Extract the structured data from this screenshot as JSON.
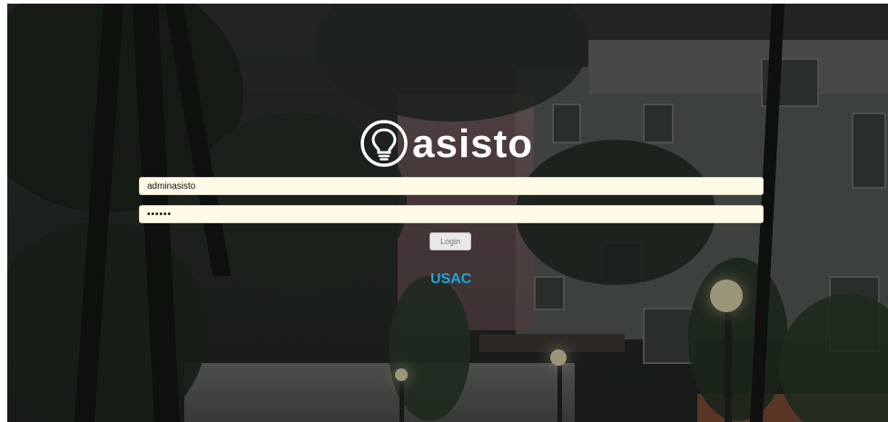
{
  "logo": {
    "icon": "lightbulb-icon",
    "text": "asisto"
  },
  "login_form": {
    "username_value": "adminasisto",
    "password_value": "••••••",
    "login_label": "Login"
  },
  "footer": {
    "org_label": "USAC"
  },
  "colors": {
    "accent": "#1aa6d9",
    "field_bg": "#fffbe6"
  }
}
